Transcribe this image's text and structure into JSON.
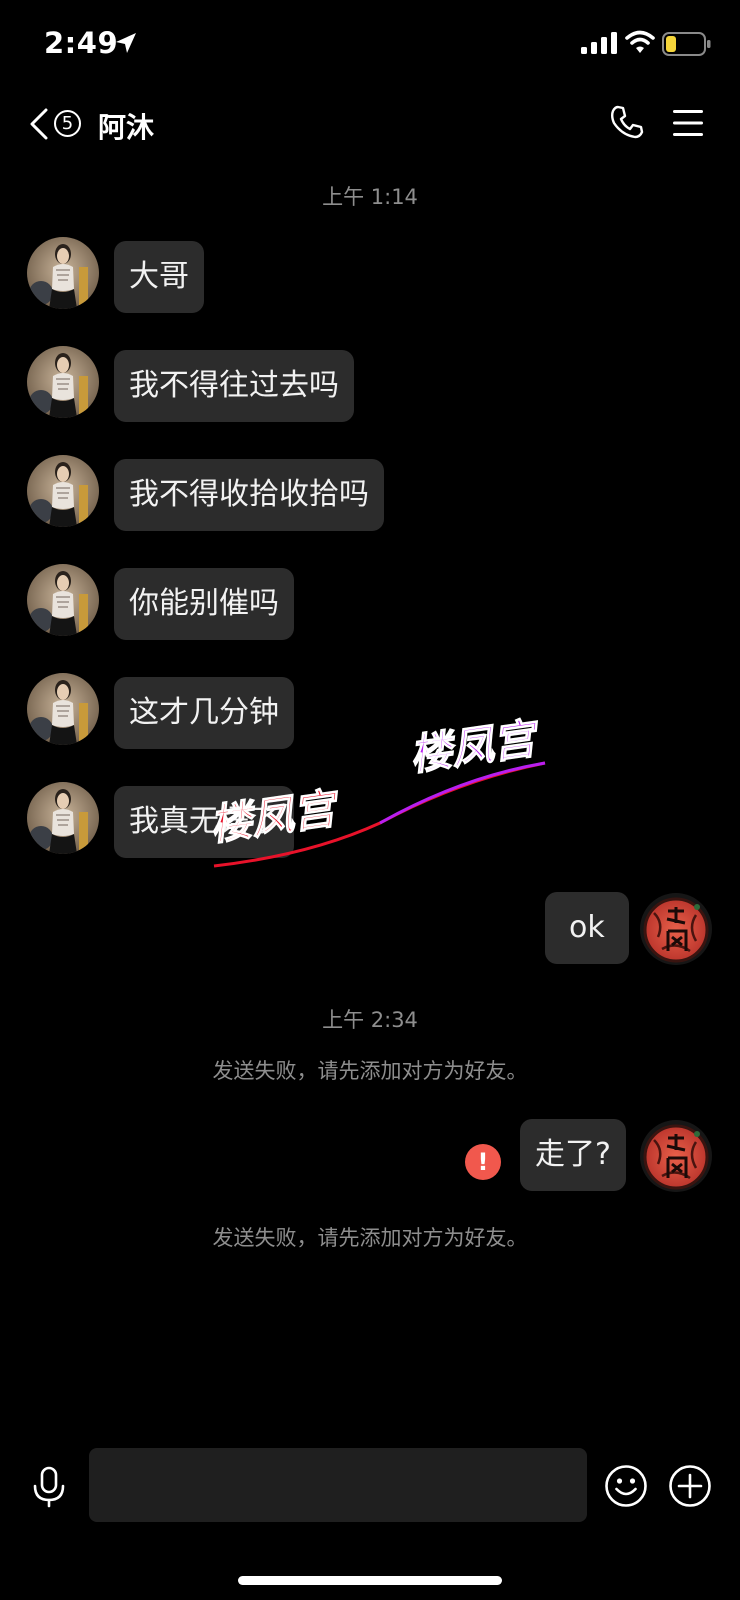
{
  "status_bar": {
    "time": "2:49",
    "icons": [
      "location-arrow-icon",
      "signal-icon",
      "wifi-icon",
      "battery-low-icon"
    ],
    "battery_color": "#f5d53a"
  },
  "header": {
    "unread_count": "5",
    "title": "阿沐",
    "icons": [
      "back-chevron-icon",
      "phone-icon",
      "menu-icon"
    ]
  },
  "messages": {
    "timestamp_1": "上午 1:14",
    "incoming": [
      {
        "text": "大哥"
      },
      {
        "text": "我不得往过去吗"
      },
      {
        "text": "我不得收拾收拾吗"
      },
      {
        "text": "你能别催吗"
      },
      {
        "text": "这才几分钟"
      },
      {
        "text": "我真无语了"
      }
    ],
    "outgoing_1": "ok",
    "timestamp_2": "上午 2:34",
    "system_notice_1": "发送失败，请先添加对方为好友。",
    "outgoing_2": "走了?",
    "system_notice_2": "发送失败，请先添加对方为好友。",
    "failed_icon": "exclamation-icon",
    "failed_color": "#f1584d"
  },
  "watermark": {
    "text_1": "楼凤宫",
    "text_2": "楼凤宫",
    "color_1": "#e8122a",
    "color_2": "#b81ff0"
  },
  "input_bar": {
    "value": "",
    "placeholder": "",
    "icons": [
      "microphone-icon",
      "emoji-icon",
      "plus-icon"
    ]
  },
  "colors": {
    "background": "#000000",
    "bubble": "#2c2c2c",
    "muted_text": "#8e8e8e"
  }
}
